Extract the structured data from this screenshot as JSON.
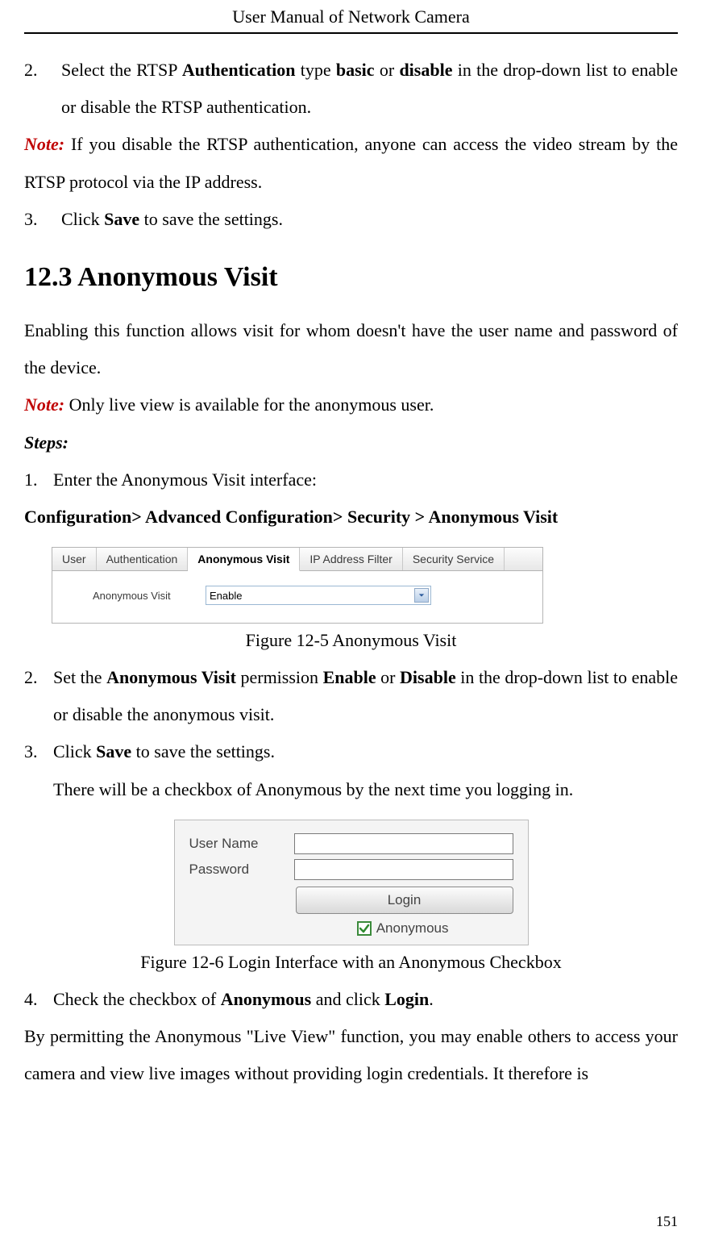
{
  "header": {
    "title": "User Manual of Network Camera"
  },
  "page_number": "151",
  "intro_list": {
    "n2": "2.",
    "t2a": "Select the RTSP ",
    "t2b": "Authentication",
    "t2c": " type ",
    "t2d": "basic",
    "t2e": " or ",
    "t2f": "disable",
    "t2g": " in the drop-down list to enable or disable the RTSP authentication.",
    "note_label": "Note:",
    "note_text": " If you disable the RTSP authentication, anyone can access the video stream by the RTSP protocol via the IP address.",
    "n3": "3.",
    "t3a": "Click ",
    "t3b": "Save",
    "t3c": " to save the settings."
  },
  "section": {
    "num": "12.3",
    "title": "Anonymous Visit"
  },
  "body": {
    "intro": "Enabling this function allows visit for whom doesn't have the user name and password of the device.",
    "note_label": "Note:",
    "note_text": " Only live view is available for the anonymous user.",
    "steps_label": "Steps:",
    "s1n": "1.",
    "s1t": "Enter the Anonymous Visit interface:",
    "navpath": "Configuration> Advanced Configuration> Security > Anonymous Visit",
    "fig125_caption": "Figure 12-5 Anonymous Visit",
    "s2n": "2.",
    "s2a": "Set the ",
    "s2b": "Anonymous Visit",
    "s2c": " permission ",
    "s2d": "Enable",
    "s2e": " or ",
    "s2f": "Disable",
    "s2g": " in the drop-down list to enable or disable the anonymous visit.",
    "s3n": "3.",
    "s3a": "Click ",
    "s3b": "Save",
    "s3c": " to save the settings.",
    "s3_extra": "There will be a checkbox of Anonymous by the next time you logging in.",
    "fig126_caption": "Figure 12-6 Login Interface with an Anonymous Checkbox",
    "s4n": "4.",
    "s4a": "Check the checkbox of ",
    "s4b": "Anonymous",
    "s4c": " and click ",
    "s4d": "Login",
    "s4e": ".",
    "permit": "By permitting the Anonymous \"Live View\" function, you may enable others to access your camera and view live images without providing login credentials. It therefore is"
  },
  "fig125": {
    "tabs": [
      "User",
      "Authentication",
      "Anonymous Visit",
      "IP Address Filter",
      "Security Service"
    ],
    "active_tab_index": 2,
    "field_label": "Anonymous Visit",
    "field_value": "Enable"
  },
  "fig126": {
    "username_label": "User Name",
    "password_label": "Password",
    "login_button": "Login",
    "anonymous_label": "Anonymous",
    "anonymous_checked": true
  }
}
